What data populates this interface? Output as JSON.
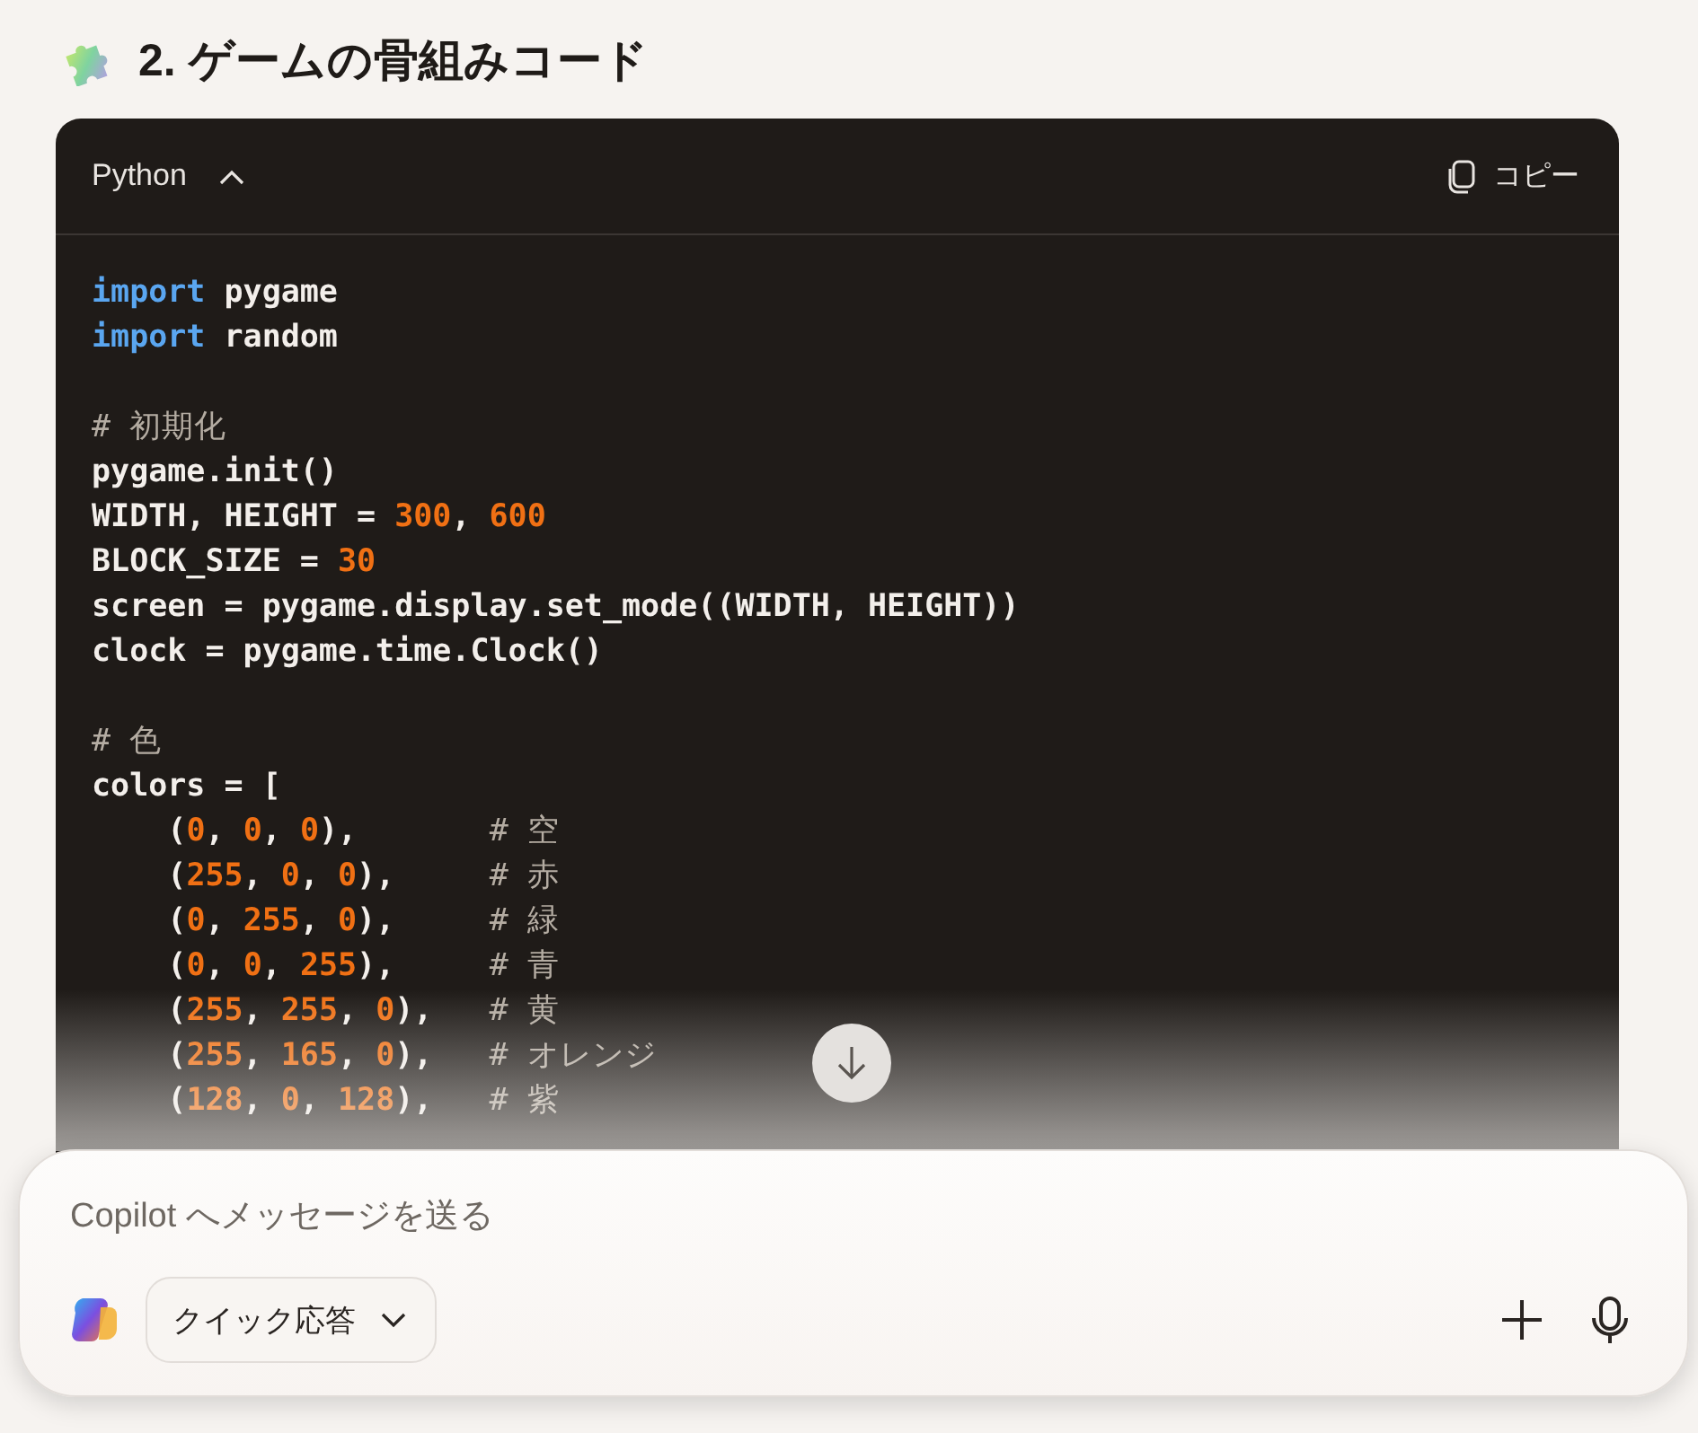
{
  "heading": {
    "text": "2. ゲームの骨組みコード"
  },
  "code_block": {
    "language": "Python",
    "expanded": true,
    "copy_label": "コピー",
    "lines": [
      {
        "kind": "code",
        "tokens": [
          {
            "kind": "keyword",
            "text": "import"
          },
          {
            "kind": "plain",
            "text": " pygame"
          }
        ]
      },
      {
        "kind": "code",
        "tokens": [
          {
            "kind": "keyword",
            "text": "import"
          },
          {
            "kind": "plain",
            "text": " random"
          }
        ]
      },
      {
        "kind": "blank"
      },
      {
        "kind": "code",
        "tokens": [
          {
            "kind": "comment",
            "text": "# 初期化"
          }
        ]
      },
      {
        "kind": "code",
        "tokens": [
          {
            "kind": "plain",
            "text": "pygame.init()"
          }
        ]
      },
      {
        "kind": "code",
        "tokens": [
          {
            "kind": "plain",
            "text": "WIDTH, HEIGHT = "
          },
          {
            "kind": "number",
            "text": "300"
          },
          {
            "kind": "plain",
            "text": ", "
          },
          {
            "kind": "number",
            "text": "600"
          }
        ]
      },
      {
        "kind": "code",
        "tokens": [
          {
            "kind": "plain",
            "text": "BLOCK_SIZE = "
          },
          {
            "kind": "number",
            "text": "30"
          }
        ]
      },
      {
        "kind": "code",
        "tokens": [
          {
            "kind": "plain",
            "text": "screen = pygame.display.set_mode((WIDTH, HEIGHT))"
          }
        ]
      },
      {
        "kind": "code",
        "tokens": [
          {
            "kind": "plain",
            "text": "clock = pygame.time.Clock()"
          }
        ]
      },
      {
        "kind": "blank"
      },
      {
        "kind": "code",
        "tokens": [
          {
            "kind": "comment",
            "text": "# 色"
          }
        ]
      },
      {
        "kind": "code",
        "tokens": [
          {
            "kind": "plain",
            "text": "colors = ["
          }
        ]
      },
      {
        "kind": "code",
        "tokens": [
          {
            "kind": "plain",
            "text": "    ("
          },
          {
            "kind": "number",
            "text": "0"
          },
          {
            "kind": "plain",
            "text": ", "
          },
          {
            "kind": "number",
            "text": "0"
          },
          {
            "kind": "plain",
            "text": ", "
          },
          {
            "kind": "number",
            "text": "0"
          },
          {
            "kind": "plain",
            "text": "),       "
          },
          {
            "kind": "comment",
            "text": "# 空"
          }
        ]
      },
      {
        "kind": "code",
        "tokens": [
          {
            "kind": "plain",
            "text": "    ("
          },
          {
            "kind": "number",
            "text": "255"
          },
          {
            "kind": "plain",
            "text": ", "
          },
          {
            "kind": "number",
            "text": "0"
          },
          {
            "kind": "plain",
            "text": ", "
          },
          {
            "kind": "number",
            "text": "0"
          },
          {
            "kind": "plain",
            "text": "),     "
          },
          {
            "kind": "comment",
            "text": "# 赤"
          }
        ]
      },
      {
        "kind": "code",
        "tokens": [
          {
            "kind": "plain",
            "text": "    ("
          },
          {
            "kind": "number",
            "text": "0"
          },
          {
            "kind": "plain",
            "text": ", "
          },
          {
            "kind": "number",
            "text": "255"
          },
          {
            "kind": "plain",
            "text": ", "
          },
          {
            "kind": "number",
            "text": "0"
          },
          {
            "kind": "plain",
            "text": "),     "
          },
          {
            "kind": "comment",
            "text": "# 緑"
          }
        ]
      },
      {
        "kind": "code",
        "tokens": [
          {
            "kind": "plain",
            "text": "    ("
          },
          {
            "kind": "number",
            "text": "0"
          },
          {
            "kind": "plain",
            "text": ", "
          },
          {
            "kind": "number",
            "text": "0"
          },
          {
            "kind": "plain",
            "text": ", "
          },
          {
            "kind": "number",
            "text": "255"
          },
          {
            "kind": "plain",
            "text": "),     "
          },
          {
            "kind": "comment",
            "text": "# 青"
          }
        ]
      },
      {
        "kind": "code",
        "tokens": [
          {
            "kind": "plain",
            "text": "    ("
          },
          {
            "kind": "number",
            "text": "255"
          },
          {
            "kind": "plain",
            "text": ", "
          },
          {
            "kind": "number",
            "text": "255"
          },
          {
            "kind": "plain",
            "text": ", "
          },
          {
            "kind": "number",
            "text": "0"
          },
          {
            "kind": "plain",
            "text": "),   "
          },
          {
            "kind": "comment",
            "text": "# 黄"
          }
        ]
      },
      {
        "kind": "code",
        "tokens": [
          {
            "kind": "plain",
            "text": "    ("
          },
          {
            "kind": "number",
            "text": "255"
          },
          {
            "kind": "plain",
            "text": ", "
          },
          {
            "kind": "number",
            "text": "165"
          },
          {
            "kind": "plain",
            "text": ", "
          },
          {
            "kind": "number",
            "text": "0"
          },
          {
            "kind": "plain",
            "text": "),   "
          },
          {
            "kind": "comment",
            "text": "# オレンジ"
          }
        ]
      },
      {
        "kind": "code",
        "tokens": [
          {
            "kind": "plain",
            "text": "    ("
          },
          {
            "kind": "number",
            "text": "128"
          },
          {
            "kind": "plain",
            "text": ", "
          },
          {
            "kind": "number",
            "text": "0"
          },
          {
            "kind": "plain",
            "text": ", "
          },
          {
            "kind": "number",
            "text": "128"
          },
          {
            "kind": "plain",
            "text": "),   "
          },
          {
            "kind": "comment",
            "text": "# 紫"
          }
        ]
      }
    ]
  },
  "composer": {
    "placeholder": "Copilot へメッセージを送る",
    "mode_button": "クイック応答"
  }
}
